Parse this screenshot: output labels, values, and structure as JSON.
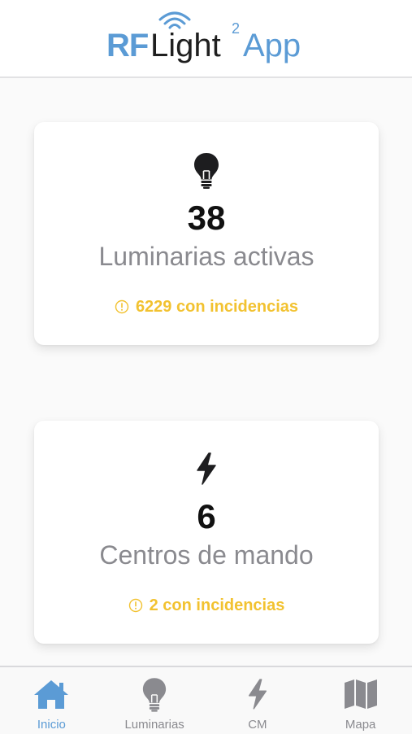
{
  "header": {
    "logo_rf": "RF",
    "logo_light": "Light",
    "logo_sup": "2",
    "logo_app": "App"
  },
  "cards": {
    "luminarias": {
      "icon": "lightbulb-icon",
      "count": "38",
      "label": "Luminarias activas",
      "warning": "6229 con incidencias"
    },
    "centros": {
      "icon": "lightning-bolt-icon",
      "count": "6",
      "label": "Centros de mando",
      "warning": "2 con incidencias"
    }
  },
  "tabbar": {
    "tabs": [
      {
        "label": "Inicio",
        "icon": "home-icon",
        "active": true
      },
      {
        "label": "Luminarias",
        "icon": "lightbulb-icon",
        "active": false
      },
      {
        "label": "CM",
        "icon": "lightning-bolt-icon",
        "active": false
      },
      {
        "label": "Mapa",
        "icon": "map-icon",
        "active": false
      }
    ]
  },
  "colors": {
    "brand_blue": "#5b9bd5",
    "warning_yellow": "#f2c230",
    "inactive_gray": "#8a8a8f",
    "text_dark": "#111111"
  }
}
